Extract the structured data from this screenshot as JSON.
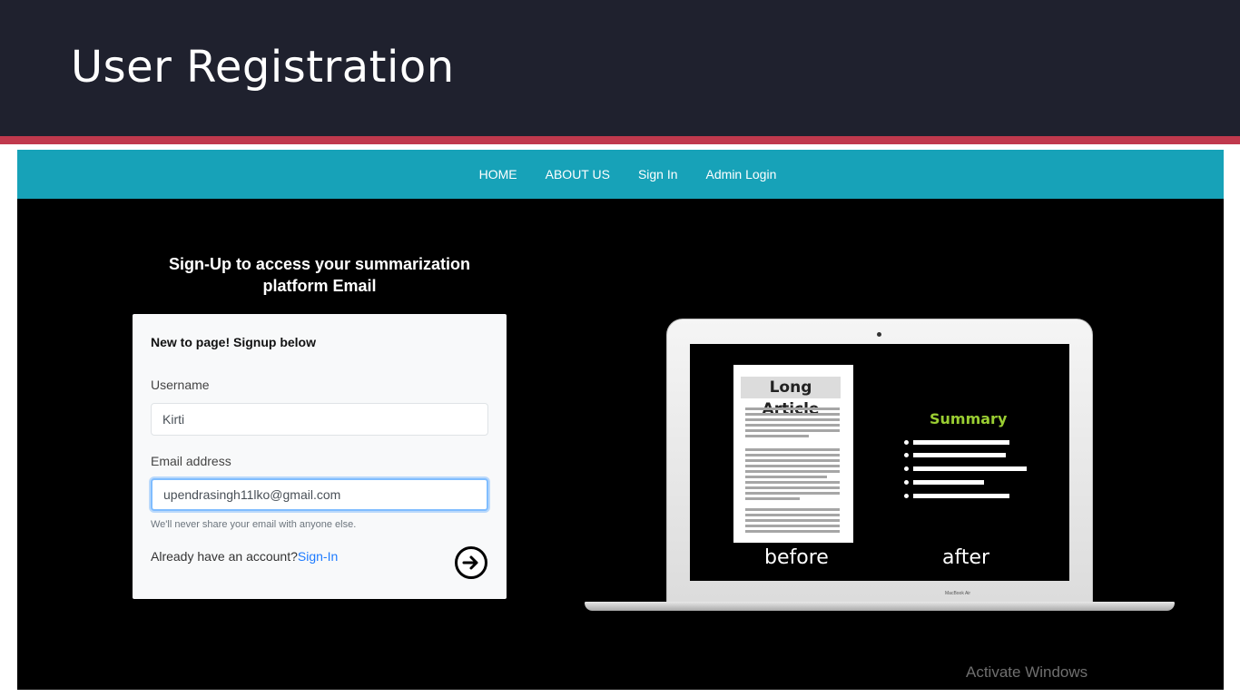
{
  "slide": {
    "title": "User Registration"
  },
  "navbar": {
    "items": [
      "HOME",
      "ABOUT US",
      "Sign In",
      "Admin Login"
    ]
  },
  "signup": {
    "heading_line1": "Sign-Up to access your summarization",
    "heading_line2": "platform Email",
    "card_title": "New to page! Signup below",
    "username_label": "Username",
    "username_value": "Kirti",
    "email_label": "Email address",
    "email_value": "upendrasingh11lko@gmail.com",
    "email_help": "We'll never share your email with anyone else.",
    "already_text": "Already have an account?",
    "signin_link": "Sign-In",
    "submit_icon": "arrow-right-circle-icon"
  },
  "illustration": {
    "doc_title": "Long Article",
    "summary_title": "Summary",
    "before_label": "before",
    "after_label": "after",
    "laptop_brand": "MacBook Air"
  },
  "watermark": {
    "text": "Activate Windows"
  },
  "colors": {
    "header_bg": "#1f212e",
    "accent": "#c0394d",
    "navbar": "#17a2b8",
    "link": "#1e7bff",
    "summary": "#9acd32"
  }
}
